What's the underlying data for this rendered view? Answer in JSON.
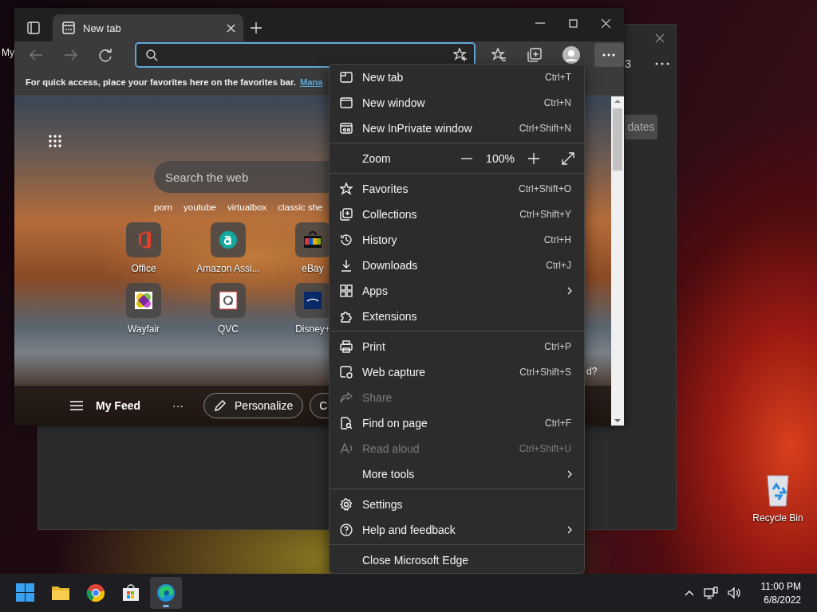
{
  "desktop": {
    "cut_icon_label": "My",
    "icons": [
      {
        "label": "Recycle Bin"
      }
    ]
  },
  "back_window": {
    "counter": "3",
    "button": "dates"
  },
  "browser": {
    "tab": {
      "title": "New tab",
      "selected": true
    },
    "favorites_bar": {
      "message": "For quick access, place your favorites here on the favorites bar.",
      "link": "Mana"
    },
    "new_tab_page": {
      "search": {
        "placeholder": "Search the web"
      },
      "suggestions": [
        "porn",
        "youtube",
        "virtualbox",
        "classic she"
      ],
      "tiles": [
        {
          "label": "Office"
        },
        {
          "label": "Amazon Assi..."
        },
        {
          "label": "eBay"
        },
        {
          "label": "Wayfair"
        },
        {
          "label": "QVC"
        },
        {
          "label": "Disney+"
        }
      ],
      "feed": {
        "title": "My Feed",
        "more": "···",
        "personalize": "Personalize",
        "cut_pill": "C"
      },
      "cut_text": "d?"
    }
  },
  "menu": {
    "groups": [
      [
        {
          "kind": "item",
          "label": "New tab",
          "shortcut": "Ctrl+T",
          "disabled": false,
          "submenu": false
        },
        {
          "kind": "item",
          "label": "New window",
          "shortcut": "Ctrl+N",
          "disabled": false,
          "submenu": false
        },
        {
          "kind": "item",
          "label": "New InPrivate window",
          "shortcut": "Ctrl+Shift+N",
          "disabled": false,
          "submenu": false
        }
      ],
      [
        {
          "kind": "zoom",
          "label": "Zoom",
          "value": "100%"
        }
      ],
      [
        {
          "kind": "item",
          "label": "Favorites",
          "shortcut": "Ctrl+Shift+O",
          "disabled": false,
          "submenu": false
        },
        {
          "kind": "item",
          "label": "Collections",
          "shortcut": "Ctrl+Shift+Y",
          "disabled": false,
          "submenu": false
        },
        {
          "kind": "item",
          "label": "History",
          "shortcut": "Ctrl+H",
          "disabled": false,
          "submenu": false
        },
        {
          "kind": "item",
          "label": "Downloads",
          "shortcut": "Ctrl+J",
          "disabled": false,
          "submenu": false
        },
        {
          "kind": "item",
          "label": "Apps",
          "disabled": false,
          "submenu": true
        },
        {
          "kind": "item",
          "label": "Extensions",
          "disabled": false,
          "submenu": false
        }
      ],
      [
        {
          "kind": "item",
          "label": "Print",
          "shortcut": "Ctrl+P",
          "disabled": false,
          "submenu": false
        },
        {
          "kind": "item",
          "label": "Web capture",
          "shortcut": "Ctrl+Shift+S",
          "disabled": false,
          "submenu": false
        },
        {
          "kind": "item",
          "label": "Share",
          "disabled": true,
          "submenu": false
        },
        {
          "kind": "item",
          "label": "Find on page",
          "shortcut": "Ctrl+F",
          "disabled": false,
          "submenu": false
        },
        {
          "kind": "item",
          "label": "Read aloud",
          "shortcut": "Ctrl+Shift+U",
          "disabled": true,
          "submenu": false
        },
        {
          "kind": "item",
          "label": "More tools",
          "disabled": false,
          "submenu": true
        }
      ],
      [
        {
          "kind": "item",
          "label": "Settings",
          "disabled": false,
          "submenu": false
        },
        {
          "kind": "item",
          "label": "Help and feedback",
          "disabled": false,
          "submenu": true
        }
      ],
      [
        {
          "kind": "item",
          "label": "Close Microsoft Edge",
          "disabled": false,
          "submenu": false
        }
      ]
    ]
  },
  "taskbar": {
    "apps": [
      {
        "selected": false
      },
      {
        "selected": false
      },
      {
        "selected": false
      },
      {
        "selected": false
      },
      {
        "selected": true
      }
    ],
    "time": "11:00 PM",
    "date": "6/8/2022"
  }
}
